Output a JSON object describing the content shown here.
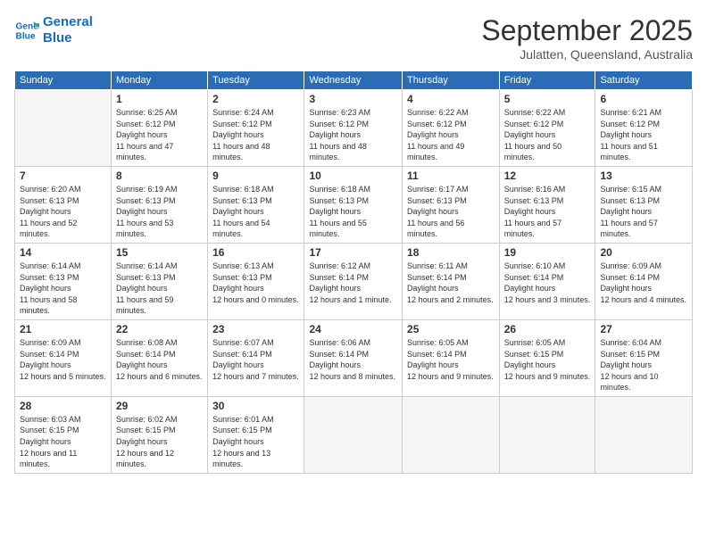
{
  "header": {
    "logo_line1": "General",
    "logo_line2": "Blue",
    "month_title": "September 2025",
    "location": "Julatten, Queensland, Australia"
  },
  "weekdays": [
    "Sunday",
    "Monday",
    "Tuesday",
    "Wednesday",
    "Thursday",
    "Friday",
    "Saturday"
  ],
  "weeks": [
    [
      {
        "day": "",
        "empty": true
      },
      {
        "day": "1",
        "sunrise": "6:25 AM",
        "sunset": "6:12 PM",
        "daylight": "11 hours and 47 minutes."
      },
      {
        "day": "2",
        "sunrise": "6:24 AM",
        "sunset": "6:12 PM",
        "daylight": "11 hours and 48 minutes."
      },
      {
        "day": "3",
        "sunrise": "6:23 AM",
        "sunset": "6:12 PM",
        "daylight": "11 hours and 48 minutes."
      },
      {
        "day": "4",
        "sunrise": "6:22 AM",
        "sunset": "6:12 PM",
        "daylight": "11 hours and 49 minutes."
      },
      {
        "day": "5",
        "sunrise": "6:22 AM",
        "sunset": "6:12 PM",
        "daylight": "11 hours and 50 minutes."
      },
      {
        "day": "6",
        "sunrise": "6:21 AM",
        "sunset": "6:12 PM",
        "daylight": "11 hours and 51 minutes."
      }
    ],
    [
      {
        "day": "7",
        "sunrise": "6:20 AM",
        "sunset": "6:13 PM",
        "daylight": "11 hours and 52 minutes."
      },
      {
        "day": "8",
        "sunrise": "6:19 AM",
        "sunset": "6:13 PM",
        "daylight": "11 hours and 53 minutes."
      },
      {
        "day": "9",
        "sunrise": "6:18 AM",
        "sunset": "6:13 PM",
        "daylight": "11 hours and 54 minutes."
      },
      {
        "day": "10",
        "sunrise": "6:18 AM",
        "sunset": "6:13 PM",
        "daylight": "11 hours and 55 minutes."
      },
      {
        "day": "11",
        "sunrise": "6:17 AM",
        "sunset": "6:13 PM",
        "daylight": "11 hours and 56 minutes."
      },
      {
        "day": "12",
        "sunrise": "6:16 AM",
        "sunset": "6:13 PM",
        "daylight": "11 hours and 57 minutes."
      },
      {
        "day": "13",
        "sunrise": "6:15 AM",
        "sunset": "6:13 PM",
        "daylight": "11 hours and 57 minutes."
      }
    ],
    [
      {
        "day": "14",
        "sunrise": "6:14 AM",
        "sunset": "6:13 PM",
        "daylight": "11 hours and 58 minutes."
      },
      {
        "day": "15",
        "sunrise": "6:14 AM",
        "sunset": "6:13 PM",
        "daylight": "11 hours and 59 minutes."
      },
      {
        "day": "16",
        "sunrise": "6:13 AM",
        "sunset": "6:13 PM",
        "daylight": "12 hours and 0 minutes."
      },
      {
        "day": "17",
        "sunrise": "6:12 AM",
        "sunset": "6:14 PM",
        "daylight": "12 hours and 1 minute."
      },
      {
        "day": "18",
        "sunrise": "6:11 AM",
        "sunset": "6:14 PM",
        "daylight": "12 hours and 2 minutes."
      },
      {
        "day": "19",
        "sunrise": "6:10 AM",
        "sunset": "6:14 PM",
        "daylight": "12 hours and 3 minutes."
      },
      {
        "day": "20",
        "sunrise": "6:09 AM",
        "sunset": "6:14 PM",
        "daylight": "12 hours and 4 minutes."
      }
    ],
    [
      {
        "day": "21",
        "sunrise": "6:09 AM",
        "sunset": "6:14 PM",
        "daylight": "12 hours and 5 minutes."
      },
      {
        "day": "22",
        "sunrise": "6:08 AM",
        "sunset": "6:14 PM",
        "daylight": "12 hours and 6 minutes."
      },
      {
        "day": "23",
        "sunrise": "6:07 AM",
        "sunset": "6:14 PM",
        "daylight": "12 hours and 7 minutes."
      },
      {
        "day": "24",
        "sunrise": "6:06 AM",
        "sunset": "6:14 PM",
        "daylight": "12 hours and 8 minutes."
      },
      {
        "day": "25",
        "sunrise": "6:05 AM",
        "sunset": "6:14 PM",
        "daylight": "12 hours and 9 minutes."
      },
      {
        "day": "26",
        "sunrise": "6:05 AM",
        "sunset": "6:15 PM",
        "daylight": "12 hours and 9 minutes."
      },
      {
        "day": "27",
        "sunrise": "6:04 AM",
        "sunset": "6:15 PM",
        "daylight": "12 hours and 10 minutes."
      }
    ],
    [
      {
        "day": "28",
        "sunrise": "6:03 AM",
        "sunset": "6:15 PM",
        "daylight": "12 hours and 11 minutes."
      },
      {
        "day": "29",
        "sunrise": "6:02 AM",
        "sunset": "6:15 PM",
        "daylight": "12 hours and 12 minutes."
      },
      {
        "day": "30",
        "sunrise": "6:01 AM",
        "sunset": "6:15 PM",
        "daylight": "12 hours and 13 minutes."
      },
      {
        "day": "",
        "empty": true
      },
      {
        "day": "",
        "empty": true
      },
      {
        "day": "",
        "empty": true
      },
      {
        "day": "",
        "empty": true
      }
    ]
  ],
  "labels": {
    "sunrise": "Sunrise:",
    "sunset": "Sunset:",
    "daylight": "Daylight hours"
  }
}
